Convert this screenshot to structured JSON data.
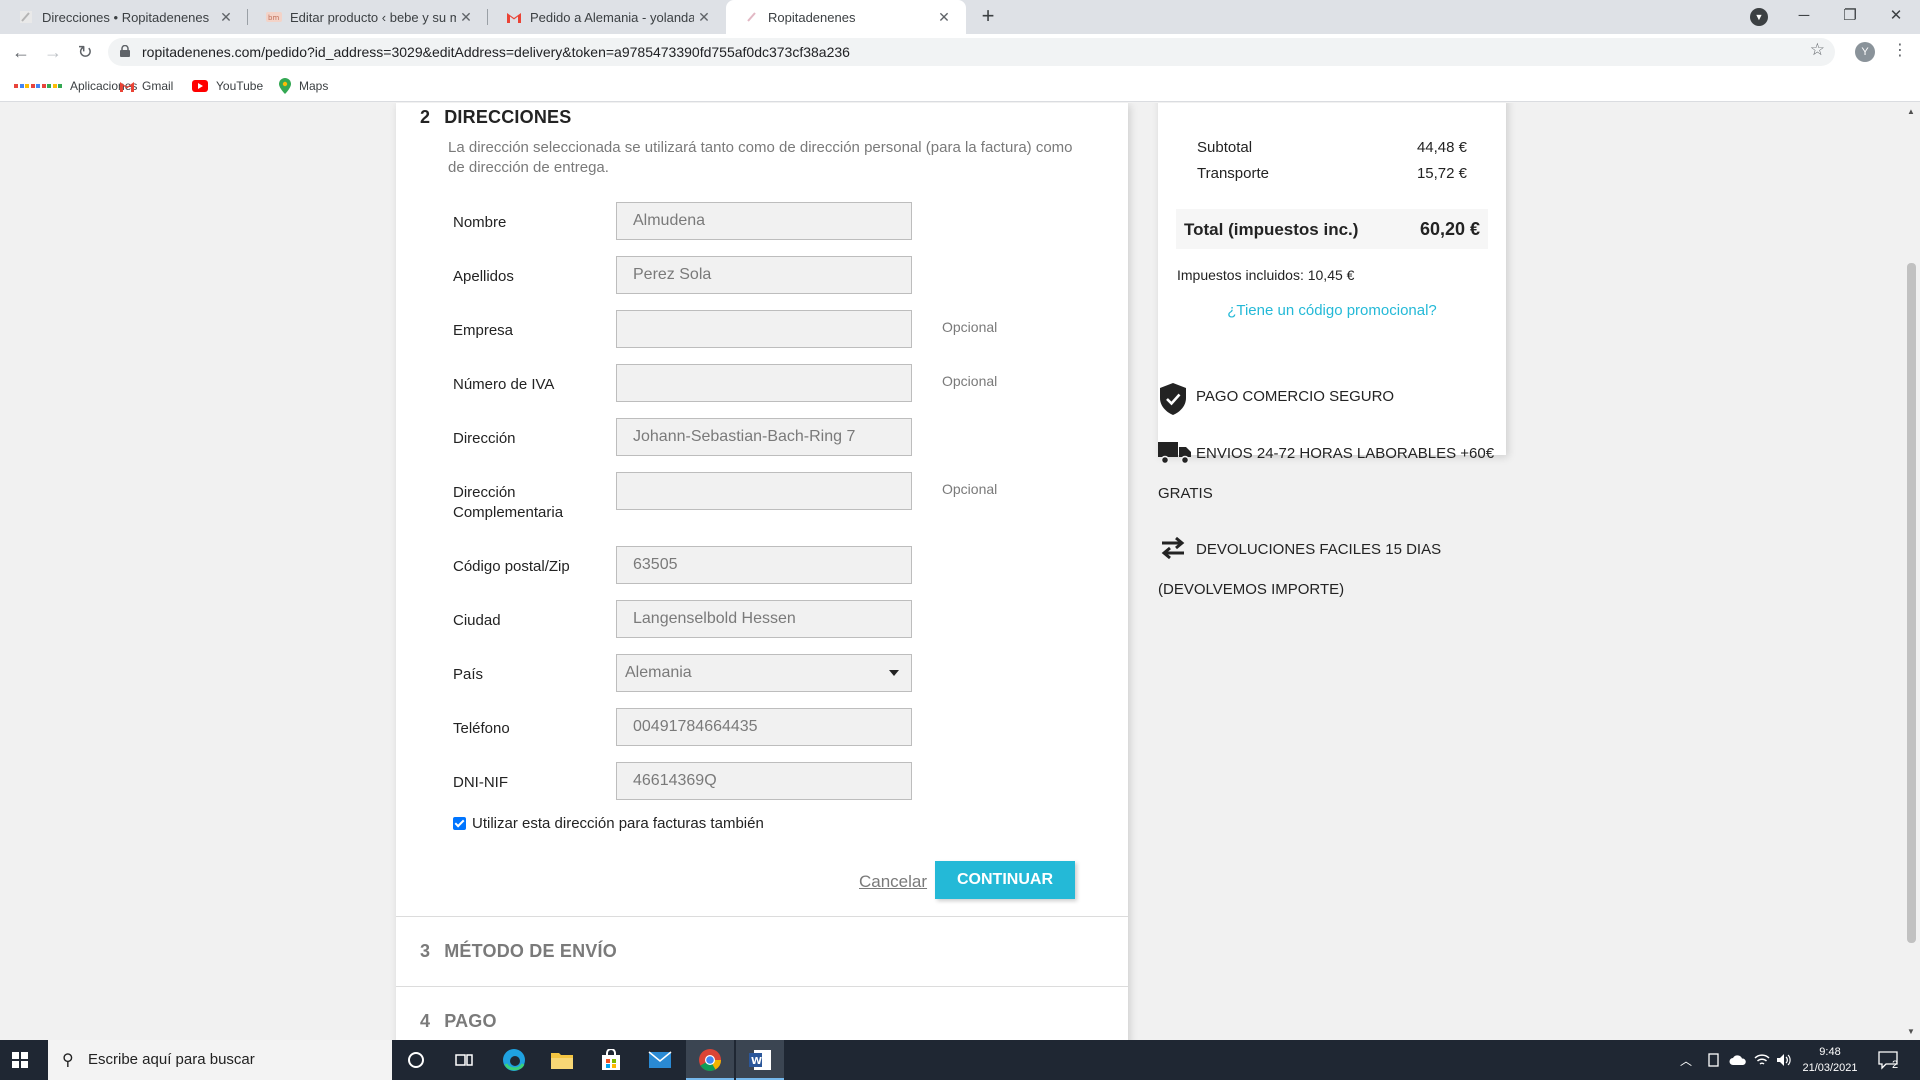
{
  "browser": {
    "tabs": [
      {
        "title": "Direcciones • Ropitadenenes",
        "active": false
      },
      {
        "title": "Editar producto ‹ bebe y su mamá",
        "active": false
      },
      {
        "title": "Pedido a Alemania - yolandaretu",
        "active": false
      },
      {
        "title": "Ropitadenenes",
        "active": true
      }
    ],
    "url": "ropitadenenes.com/pedido?id_address=3029&editAddress=delivery&token=a9785473390fd755af0dc373cf38a236",
    "profile_initial": "Y",
    "bookmarks": [
      "Aplicaciones",
      "Gmail",
      "YouTube",
      "Maps"
    ]
  },
  "checkout": {
    "step2": {
      "number": "2",
      "title": "DIRECCIONES",
      "description": "La dirección seleccionada se utilizará tanto como de dirección personal (para la factura) como de dirección de entrega."
    },
    "fields": {
      "nombre": {
        "label": "Nombre",
        "value": "Almudena"
      },
      "apellidos": {
        "label": "Apellidos",
        "value": "Perez Sola"
      },
      "empresa": {
        "label": "Empresa",
        "value": "",
        "optional": "Opcional"
      },
      "iva": {
        "label": "Número de IVA",
        "value": "",
        "optional": "Opcional"
      },
      "direccion": {
        "label": "Dirección",
        "value": "Johann-Sebastian-Bach-Ring 7"
      },
      "direccion2": {
        "label": "Dirección Complementaria",
        "value": "",
        "optional": "Opcional"
      },
      "cp": {
        "label": "Código postal/Zip",
        "value": "63505"
      },
      "ciudad": {
        "label": "Ciudad",
        "value": "Langenselbold Hessen"
      },
      "pais": {
        "label": "País",
        "value": "Alemania"
      },
      "telefono": {
        "label": "Teléfono",
        "value": "00491784664435"
      },
      "dni": {
        "label": "DNI-NIF",
        "value": "46614369Q"
      }
    },
    "use_for_invoice": {
      "label": "Utilizar esta dirección para facturas también",
      "checked": true
    },
    "cancel_label": "Cancelar",
    "continue_label": "CONTINUAR",
    "step3": {
      "number": "3",
      "title": "MÉTODO DE ENVÍO"
    },
    "step4": {
      "number": "4",
      "title": "PAGO"
    }
  },
  "summary": {
    "subtotal_label": "Subtotal",
    "subtotal_value": "44,48 €",
    "shipping_label": "Transporte",
    "shipping_value": "15,72 €",
    "total_label": "Total (impuestos inc.)",
    "total_value": "60,20 €",
    "tax_line": "Impuestos incluidos: 10,45 €",
    "promo_link": "¿Tiene un código promocional?"
  },
  "reassurance": {
    "secure": "PAGO COMERCIO SEGURO",
    "shipping_line1": "ENVIOS 24-72 HORAS LABORABLES +60€",
    "shipping_line2": "GRATIS",
    "returns_line1": "DEVOLUCIONES FACILES 15 DIAS",
    "returns_line2": "(DEVOLVEMOS IMPORTE)"
  },
  "taskbar": {
    "search_placeholder": "Escribe aquí para buscar",
    "time": "9:48",
    "date": "21/03/2021",
    "notifications": "2"
  },
  "colors": {
    "accent": "#24b9d7",
    "taskbar": "#1f2733",
    "checkbox": "#0075ff"
  }
}
